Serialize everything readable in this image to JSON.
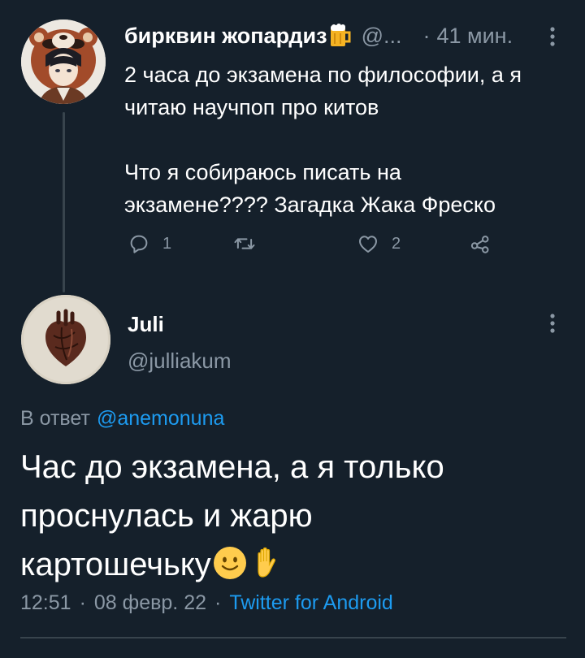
{
  "parent_tweet": {
    "author_name": "бирквин жопардиз",
    "author_badge_icon": "beer-mug-icon",
    "handle": "@...",
    "dot": "·",
    "time": "41 мин.",
    "text_lines": [
      "2 часа до экзамена по философии, а я",
      "читаю научпоп про китов",
      "Что я собираюсь писать на",
      "экзамене???? Загадка Жака Фреско"
    ],
    "actions": {
      "reply_icon": "comment-icon",
      "reply_count": "1",
      "retweet_icon": "retweet-icon",
      "like_icon": "heart-icon",
      "like_count": "2",
      "share_icon": "share-icon"
    }
  },
  "main_tweet": {
    "author_name": "Juli",
    "handle": "@julliakum",
    "reply_prefix": "В ответ",
    "reply_mention": "@anemonuna",
    "text_lines": [
      "Час до экзамена, а я только",
      "проснулась и жарю",
      "картошечьку"
    ],
    "emojis": [
      "slightly-smiling-face-emoji",
      "raised-hand-emoji"
    ],
    "time": "12:51",
    "date": "08 февр. 22",
    "separator": "·",
    "source": "Twitter for Android"
  },
  "colors": {
    "background": "#15202b",
    "primary_text": "#ffffff",
    "secondary_text": "#8b98a5",
    "link": "#1d9bf0",
    "divider": "#38444d"
  }
}
